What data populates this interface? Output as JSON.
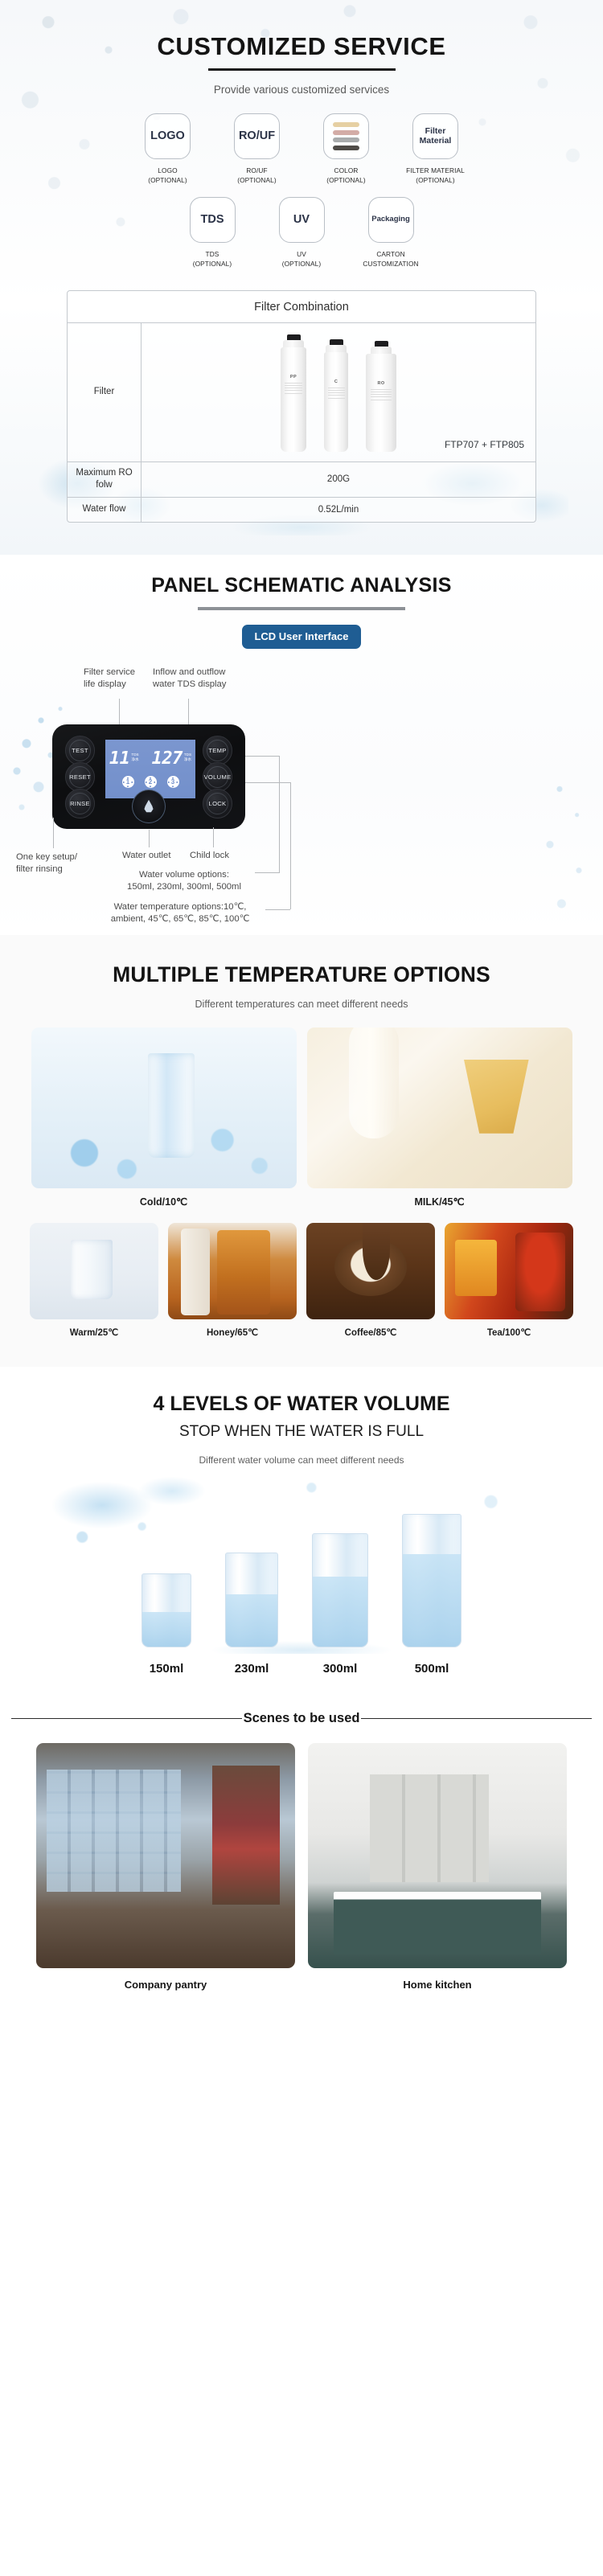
{
  "customized": {
    "title": "CUSTOMIZED SERVICE",
    "subtitle": "Provide various customized services",
    "options_row1": [
      {
        "box_text": "LOGO",
        "cap_line1": "LOGO",
        "cap_line2": "(OPTIONAL)",
        "icon": "text-badge"
      },
      {
        "box_text": "RO/UF",
        "cap_line1": "RO/UF",
        "cap_line2": "(OPTIONAL)",
        "icon": "text-badge"
      },
      {
        "box_text": "",
        "cap_line1": "COLOR",
        "cap_line2": "(OPTIONAL)",
        "icon": "color-swatches-icon"
      },
      {
        "box_text": "Filter Material",
        "cap_line1": "FILTER MATERIAL",
        "cap_line2": "(OPTIONAL)",
        "icon": "text-badge"
      }
    ],
    "options_row2": [
      {
        "box_text": "TDS",
        "cap_line1": "TDS",
        "cap_line2": "(OPTIONAL)",
        "icon": "text-badge"
      },
      {
        "box_text": "UV",
        "cap_line1": "UV",
        "cap_line2": "(OPTIONAL)",
        "icon": "text-badge"
      },
      {
        "box_text": "Packaging",
        "cap_line1": "CARTON",
        "cap_line2": "CUSTOMIZATION",
        "icon": "text-badge"
      }
    ],
    "swatch_colors": [
      "#e6d0a3",
      "#d3aca6",
      "#a9acad",
      "#4f4c48"
    ],
    "table": {
      "header": "Filter Combination",
      "rows": [
        {
          "label": "Filter",
          "value": "",
          "model": "FTP707 + FTP805"
        },
        {
          "label": "Maximum RO folw",
          "value": "200G",
          "model": ""
        },
        {
          "label": "Water flow",
          "value": "0.52L/min",
          "model": ""
        }
      ],
      "cartridges": [
        {
          "name": "PP"
        },
        {
          "name": "C"
        },
        {
          "name": "RO"
        }
      ]
    }
  },
  "panel": {
    "title": "PANEL SCHEMATIC ANALYSIS",
    "badge": "LCD User Interface",
    "callouts": {
      "filter_life": "Filter service\nlife display",
      "tds_display": "Inflow and outflow\nwater TDS display",
      "one_key": "One key setup/\nfilter rinsing",
      "water_outlet": "Water outlet",
      "child_lock": "Child lock",
      "volume_options": "Water volume options:\n150ml, 230ml, 300ml, 500ml",
      "temp_options": "Water temperature options:10℃,\nambient,  45℃,  65℃,  85℃,  100℃"
    },
    "buttons_left": [
      "TEST",
      "RESET",
      "RINSE"
    ],
    "buttons_right": [
      "TEMP",
      "VOLUME",
      "LOCK"
    ],
    "lcd": {
      "left_value": "11",
      "left_tag_top": "TDS",
      "left_tag_bottom": "净水",
      "right_value": "127",
      "right_tag_top": "TDS",
      "right_tag_bottom": "净水",
      "filter_icons": [
        "1",
        "2",
        "3"
      ],
      "screen_color": "#7390cb"
    },
    "accent_color": "#1f5d93"
  },
  "temperature": {
    "title": "MULTIPLE TEMPERATURE OPTIONS",
    "subtitle": "Different temperatures can meet different needs",
    "top_cards": [
      {
        "label": "Cold/10℃",
        "image": "iced-water-glass"
      },
      {
        "label": "MILK/45℃",
        "image": "milk-pour"
      }
    ],
    "bottom_cards": [
      {
        "label": "Warm/25℃",
        "image": "warm-water-glass"
      },
      {
        "label": "Honey/65℃",
        "image": "honey-jar"
      },
      {
        "label": "Coffee/85℃",
        "image": "coffee-pour"
      },
      {
        "label": "Tea/100℃",
        "image": "tea-cup"
      }
    ]
  },
  "volume": {
    "title": "4 LEVELS OF WATER VOLUME",
    "subtitle": "STOP WHEN THE WATER IS FULL",
    "note": "Different water volume can meet different needs",
    "levels": [
      {
        "label": "150ml"
      },
      {
        "label": "230ml"
      },
      {
        "label": "300ml"
      },
      {
        "label": "500ml"
      }
    ]
  },
  "scenes": {
    "heading": "Scenes to be used",
    "cards": [
      {
        "caption": "Company pantry",
        "image": "office-pantry-photo"
      },
      {
        "caption": "Home kitchen",
        "image": "home-kitchen-photo"
      }
    ]
  }
}
